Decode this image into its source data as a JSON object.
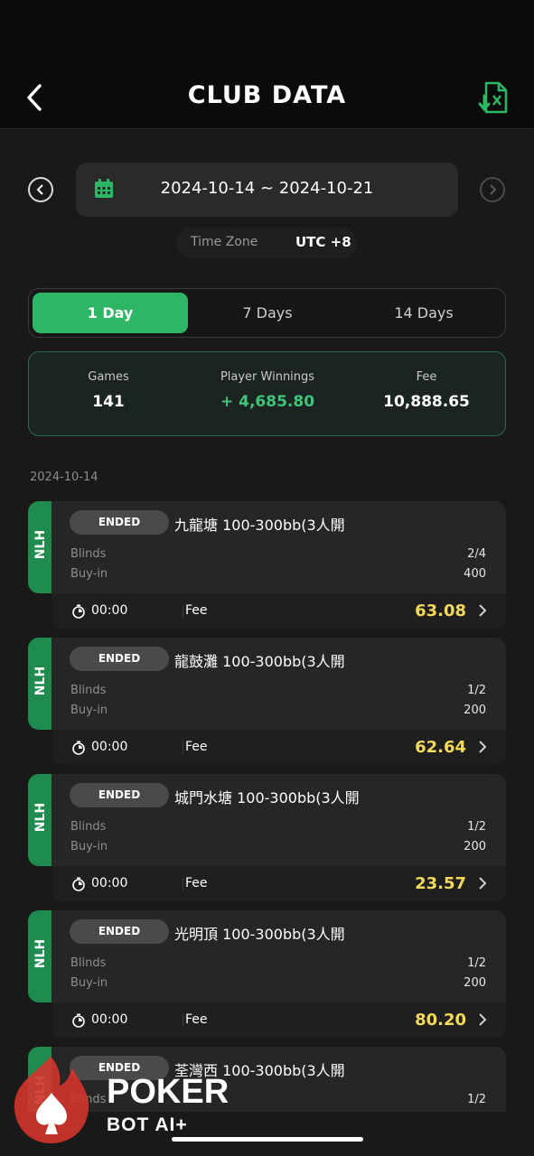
{
  "header": {
    "title": "CLUB DATA",
    "back_icon": "chevron-left-icon",
    "export_icon": "excel-export-icon"
  },
  "date_range": {
    "text": "2024-10-14 ~ 2024-10-21",
    "prev_icon": "chevron-left-icon",
    "next_icon": "chevron-right-icon",
    "calendar_icon": "calendar-icon"
  },
  "timezone": {
    "label": "Time Zone",
    "value": "UTC +8"
  },
  "tabs": [
    {
      "label": "1 Day",
      "active": true
    },
    {
      "label": "7 Days",
      "active": false
    },
    {
      "label": "14 Days",
      "active": false
    }
  ],
  "summary": {
    "games_label": "Games",
    "games_value": "141",
    "winnings_label": "Player Winnings",
    "winnings_value": "+ 4,685.80",
    "fee_label": "Fee",
    "fee_value": "10,888.65"
  },
  "section_date": "2024-10-14",
  "games": [
    {
      "type": "NLH",
      "status": "ENDED",
      "name": "九龍塘 100-300bb(3人開",
      "blinds_label": "Blinds",
      "blinds": "2/4",
      "buyin_label": "Buy-in",
      "buyin": "400",
      "time": "00:00",
      "fee_label": "Fee",
      "fee": "63.08"
    },
    {
      "type": "NLH",
      "status": "ENDED",
      "name": "龍鼓灘 100-300bb(3人開",
      "blinds_label": "Blinds",
      "blinds": "1/2",
      "buyin_label": "Buy-in",
      "buyin": "200",
      "time": "00:00",
      "fee_label": "Fee",
      "fee": "62.64"
    },
    {
      "type": "NLH",
      "status": "ENDED",
      "name": "城門水塘 100-300bb(3人開",
      "blinds_label": "Blinds",
      "blinds": "1/2",
      "buyin_label": "Buy-in",
      "buyin": "200",
      "time": "00:00",
      "fee_label": "Fee",
      "fee": "23.57"
    },
    {
      "type": "NLH",
      "status": "ENDED",
      "name": "光明頂 100-300bb(3人開",
      "blinds_label": "Blinds",
      "blinds": "1/2",
      "buyin_label": "Buy-in",
      "buyin": "200",
      "time": "00:00",
      "fee_label": "Fee",
      "fee": "80.20"
    },
    {
      "type": "NLH",
      "status": "ENDED",
      "name": "荃灣西 100-300bb(3人開",
      "blinds_label": "Blinds",
      "blinds": "1/2"
    }
  ],
  "logo": {
    "line1": "POKER",
    "line2": "BOT AI+"
  },
  "colors": {
    "accent_green": "#2fb566",
    "fee_yellow": "#f5d95b",
    "nlh_tag": "#1f8b4f"
  }
}
